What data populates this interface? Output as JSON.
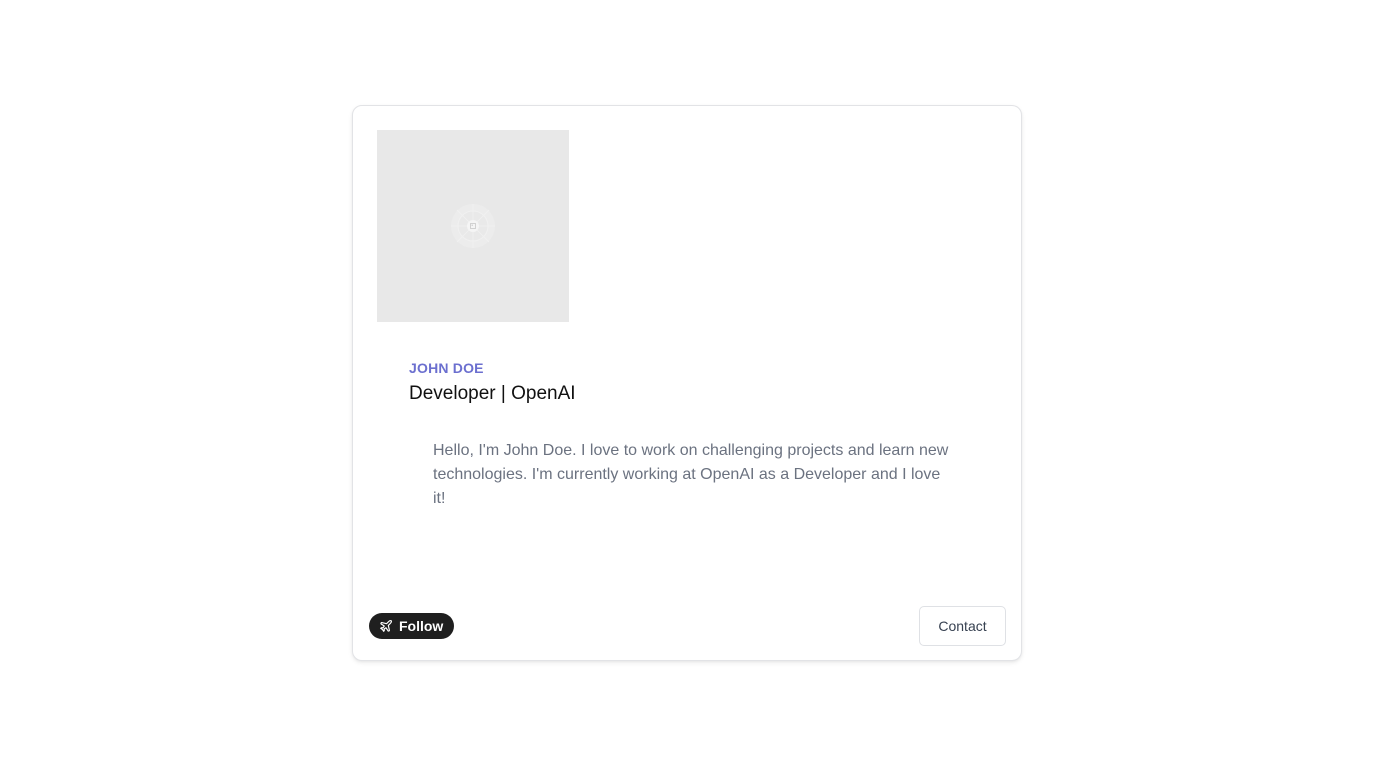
{
  "profile": {
    "name": "JOHN DOE",
    "role": "Developer | OpenAI",
    "bio": "Hello, I'm John Doe. I love to work on challenging projects and learn new technologies. I'm currently working at OpenAI as a Developer and I love it!"
  },
  "actions": {
    "follow_label": "Follow",
    "follow_icon": "send-plane-icon",
    "contact_label": "Contact"
  },
  "colors": {
    "name_accent": "#6b6fcf",
    "follow_bg": "#1f1f1f",
    "avatar_placeholder": "#e8e8e8"
  }
}
